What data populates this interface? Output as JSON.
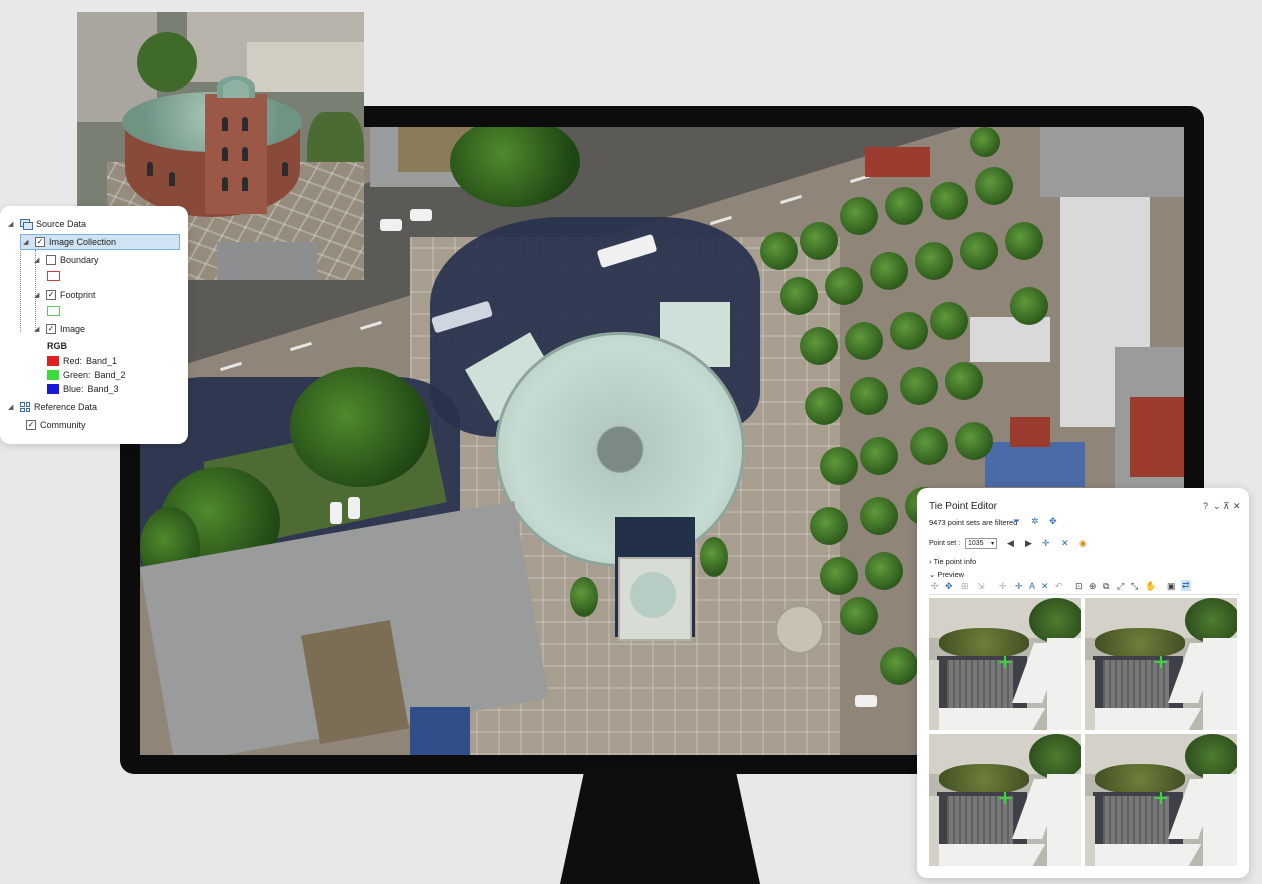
{
  "contents": {
    "source_data": "Source Data",
    "image_collection": "Image Collection",
    "boundary": "Boundary",
    "footprint": "Footprint",
    "image": "Image",
    "rgb": "RGB",
    "bands": [
      {
        "label": "Red:",
        "value": "Band_1",
        "color": "#e02020"
      },
      {
        "label": "Green:",
        "value": "Band_2",
        "color": "#3ddc3d"
      },
      {
        "label": "Blue:",
        "value": "Band_3",
        "color": "#1a1ad6"
      }
    ],
    "boundary_color": "#d04040",
    "footprint_color": "#5ccc5c",
    "reference_data": "Reference Data",
    "community": "Community"
  },
  "tie_point_editor": {
    "title": "Tie Point Editor",
    "filter_status": "9473 point sets are filtered",
    "point_set_label": "Point set :",
    "point_set_value": "1035",
    "tie_point_info": "Tie point info",
    "preview": "Preview",
    "window_controls": [
      "?",
      "⌄",
      "⊼",
      "✕"
    ]
  }
}
